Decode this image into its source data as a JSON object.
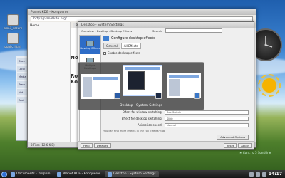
{
  "desktop": {
    "icons": [
      {
        "label": "email_secure"
      },
      {
        "label": "public_html"
      }
    ],
    "widget_text": "☀ Cont. to 5 Sunshine"
  },
  "background_window": {
    "title": "Planet KDE - Konqueror",
    "url": "http://planetkde.org/",
    "tabs": [
      "Planet KDE"
    ],
    "left_heading": "Home",
    "status": "8 Files (12.6 KiB)",
    "behind_text": [
      "Nov",
      "Rob",
      "Ko"
    ]
  },
  "dolphin_rows": [
    "Docs",
    "Local",
    "Media",
    "Trash",
    "Net",
    "Root"
  ],
  "front_window": {
    "title": "Desktop - System Settings",
    "breadcrumb": "Overview › Desktop › Desktop Effects",
    "search_label": "Search:",
    "side_items": [
      {
        "label": "Desktop Effects",
        "selected": true
      },
      {
        "label": "Multiple Desktops",
        "selected": false
      }
    ],
    "section_heading": "Configure desktop effects",
    "sub_tabs": [
      "General",
      "All Effects"
    ],
    "enable_checkbox": "Enable desktop effects",
    "rows": [
      {
        "label": "Effect for window switching:",
        "value": "Box Switch"
      },
      {
        "label": "Effect for desktop switching:",
        "value": "Slide"
      },
      {
        "label": "Animation speed:",
        "value": "Normal"
      }
    ],
    "note": "You can find more effects in the \"All Effects\" tab",
    "advanced_button": "Advanced Options",
    "help_button": "Help",
    "defaults_button": "Defaults",
    "reset_button": "Reset",
    "apply_button": "Apply"
  },
  "switcher": {
    "caption": "Desktop - System Settings"
  },
  "taskbar": {
    "items": [
      {
        "label": "Documents - Dolphin",
        "active": false
      },
      {
        "label": "Planet KDE - Konqueror",
        "active": false
      },
      {
        "label": "Desktop - System Settings",
        "active": true
      }
    ],
    "clock": "14:17"
  },
  "colors": {
    "selection": "#2d6cc7",
    "taskbar": "#1f1f1f",
    "traffic_red": "#e02020",
    "traffic_green": "#20c040"
  }
}
